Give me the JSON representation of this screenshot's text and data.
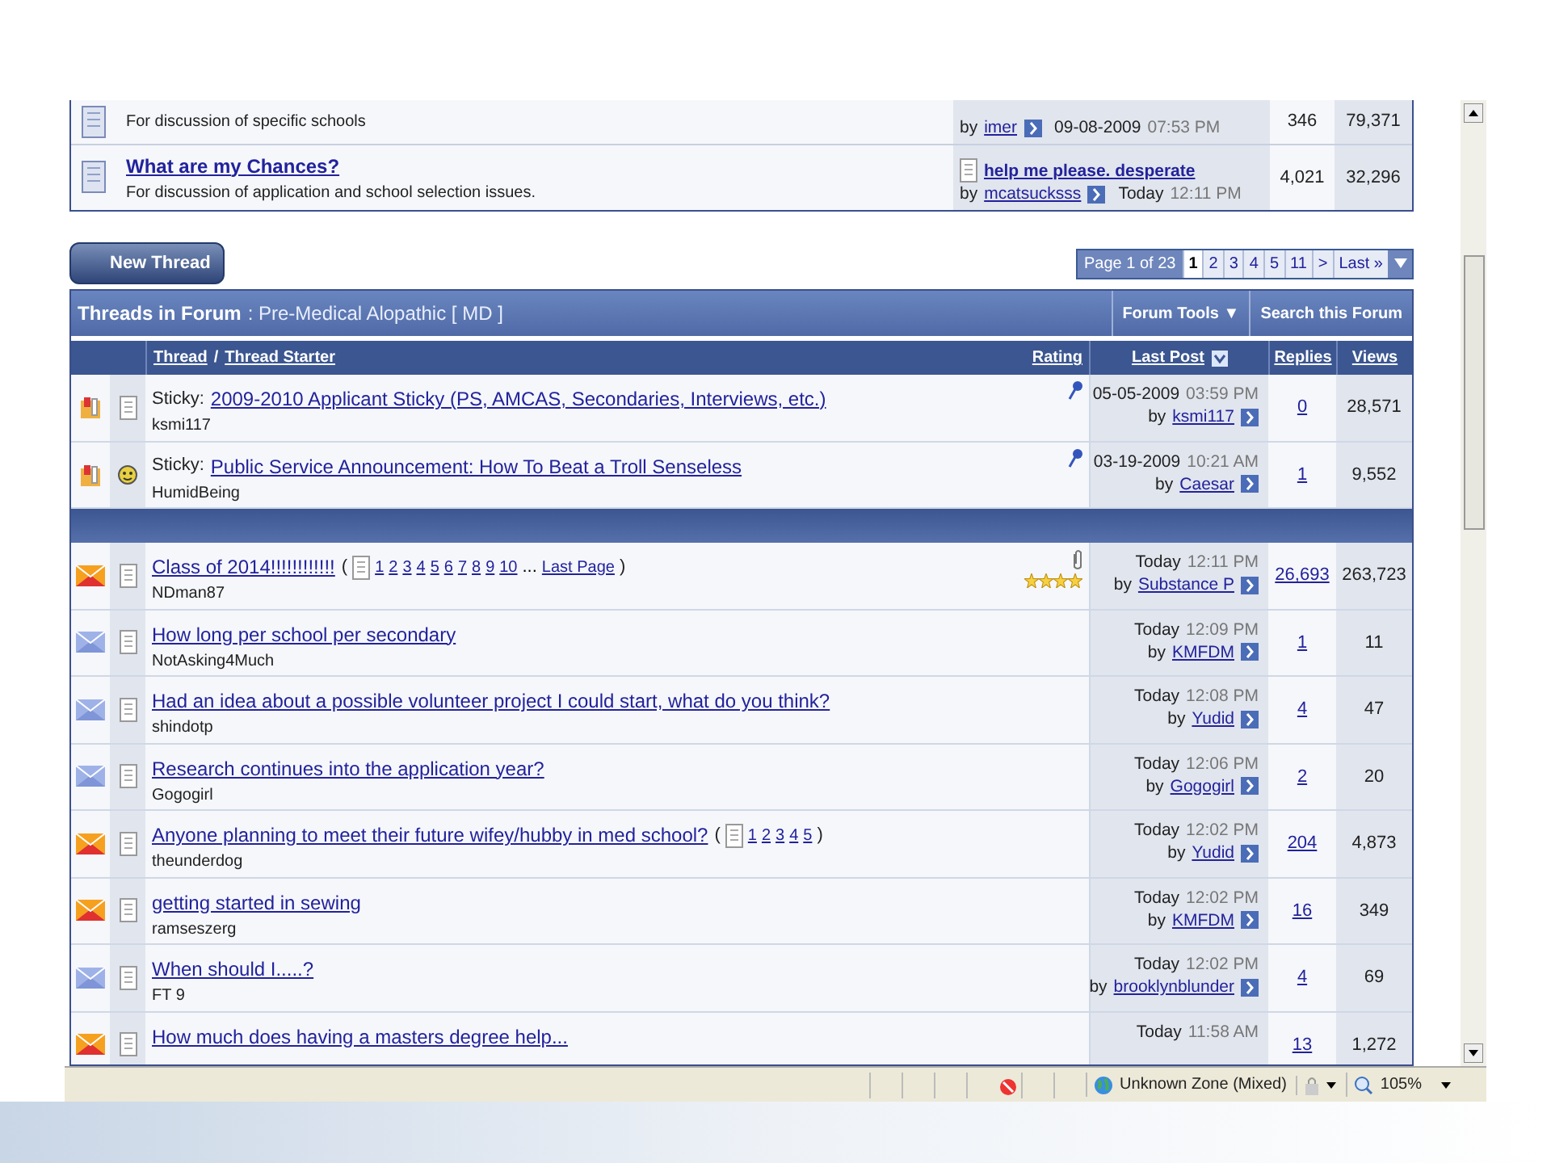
{
  "forums": [
    {
      "description": "For discussion of specific schools",
      "last_post": {
        "by_label": "by",
        "by": "imer",
        "date": "09-08-2009",
        "time": "07:53 PM"
      },
      "threads": "346",
      "posts": "79,371"
    },
    {
      "title": "What are my Chances?",
      "description": "For discussion of application and school selection issues.",
      "last_post": {
        "title": "help me please. desperate",
        "by_label": "by",
        "by": "mcatsucksss",
        "date": "Today",
        "time": "12:11 PM"
      },
      "threads": "4,021",
      "posts": "32,296"
    }
  ],
  "new_thread_button": "New Thread",
  "pagination": {
    "label": "Page 1 of 23",
    "pages": [
      {
        "label": "1",
        "selected": true
      },
      {
        "label": "2",
        "selected": false
      },
      {
        "label": "3",
        "selected": false
      },
      {
        "label": "4",
        "selected": false
      },
      {
        "label": "5",
        "selected": false
      },
      {
        "label": "11",
        "selected": false
      },
      {
        "label": ">",
        "selected": false
      },
      {
        "label": "Last »",
        "selected": false
      }
    ]
  },
  "forum_header": {
    "title": "Threads in Forum",
    "subtitle": ": Pre-Medical Alopathic [ MD ]",
    "tools": [
      "Forum Tools ▼",
      "Search this Forum"
    ]
  },
  "columns": {
    "thread": "Thread",
    "separator": "/",
    "starter": "Thread Starter",
    "rating": "Rating",
    "last_post": "Last Post",
    "replies": "Replies",
    "views": "Views"
  },
  "sticky_threads": [
    {
      "status_icon": {
        "kind": "sticky"
      },
      "post_icon": {
        "kind": "page"
      },
      "prefix": "Sticky:",
      "title": "2009-2010 Applicant Sticky (PS, AMCAS, Secondaries, Interviews, etc.)",
      "starter": "ksmi117",
      "pinned": true,
      "last_post": {
        "date": "05-05-2009",
        "time": "03:59 PM",
        "by_label": "by",
        "by": "ksmi117"
      },
      "replies": "0",
      "views": "28,571"
    },
    {
      "status_icon": {
        "kind": "sticky"
      },
      "post_icon": {
        "kind": "smiley"
      },
      "prefix": "Sticky:",
      "title": "Public Service Announcement: How To Beat a Troll Senseless",
      "starter": "HumidBeing",
      "pinned": true,
      "last_post": {
        "date": "03-19-2009",
        "time": "10:21 AM",
        "by_label": "by",
        "by": "Caesar"
      },
      "replies": "1",
      "views": "9,552"
    }
  ],
  "threads": [
    {
      "status_icon": {
        "kind": "hot"
      },
      "post_icon": {
        "kind": "page"
      },
      "title": "Class of 2014!!!!!!!!!!!!",
      "page_links": {
        "open": "(",
        "pages": [
          "1",
          "2",
          "3",
          "4",
          "5",
          "6",
          "7",
          "8",
          "9",
          "10"
        ],
        "ellipsis": "...",
        "last_page": "Last Page",
        "close": ")"
      },
      "starter": "NDman87",
      "attachment": true,
      "stars": 4,
      "last_post": {
        "date": "Today",
        "time": "12:11 PM",
        "by_label": "by",
        "by": "Substance P"
      },
      "replies": "26,693",
      "views": "263,723"
    },
    {
      "status_icon": {
        "kind": "new"
      },
      "post_icon": {
        "kind": "page"
      },
      "title": "How long per school per secondary",
      "starter": "NotAsking4Much",
      "last_post": {
        "date": "Today",
        "time": "12:09 PM",
        "by_label": "by",
        "by": "KMFDM"
      },
      "replies": "1",
      "views": "11"
    },
    {
      "status_icon": {
        "kind": "new"
      },
      "post_icon": {
        "kind": "page"
      },
      "title": "Had an idea about a possible volunteer project I could start, what do you think?",
      "starter": "shindotp",
      "last_post": {
        "date": "Today",
        "time": "12:08 PM",
        "by_label": "by",
        "by": "Yudid"
      },
      "replies": "4",
      "views": "47"
    },
    {
      "status_icon": {
        "kind": "new"
      },
      "post_icon": {
        "kind": "page"
      },
      "title": "Research continues into the application year?",
      "starter": "Gogogirl",
      "last_post": {
        "date": "Today",
        "time": "12:06 PM",
        "by_label": "by",
        "by": "Gogogirl"
      },
      "replies": "2",
      "views": "20"
    },
    {
      "status_icon": {
        "kind": "hot"
      },
      "post_icon": {
        "kind": "page"
      },
      "title": "Anyone planning to meet their future wifey/hubby in med school?",
      "page_links": {
        "open": "(",
        "pages": [
          "1",
          "2",
          "3",
          "4",
          "5"
        ],
        "close": ")"
      },
      "starter": "theunderdog",
      "last_post": {
        "date": "Today",
        "time": "12:02 PM",
        "by_label": "by",
        "by": "Yudid"
      },
      "replies": "204",
      "views": "4,873"
    },
    {
      "status_icon": {
        "kind": "hot"
      },
      "post_icon": {
        "kind": "page"
      },
      "title": "getting started in sewing",
      "starter": "ramseszerg",
      "last_post": {
        "date": "Today",
        "time": "12:02 PM",
        "by_label": "by",
        "by": "KMFDM"
      },
      "replies": "16",
      "views": "349"
    },
    {
      "status_icon": {
        "kind": "new"
      },
      "post_icon": {
        "kind": "page"
      },
      "title": "When should I.....?",
      "starter": "FT 9",
      "last_post": {
        "date": "Today",
        "time": "12:02 PM",
        "by_label": "by",
        "by": "brooklynblunder"
      },
      "replies": "4",
      "views": "69"
    },
    {
      "status_icon": {
        "kind": "hot"
      },
      "post_icon": {
        "kind": "page"
      },
      "title": "How much does having a masters degree help...",
      "last_post": {
        "date": "Today",
        "time": "11:58 AM"
      },
      "replies": "13",
      "views": "1,272"
    }
  ],
  "status_bar": {
    "zone": "Unknown Zone (Mixed)",
    "zoom": "105%"
  }
}
